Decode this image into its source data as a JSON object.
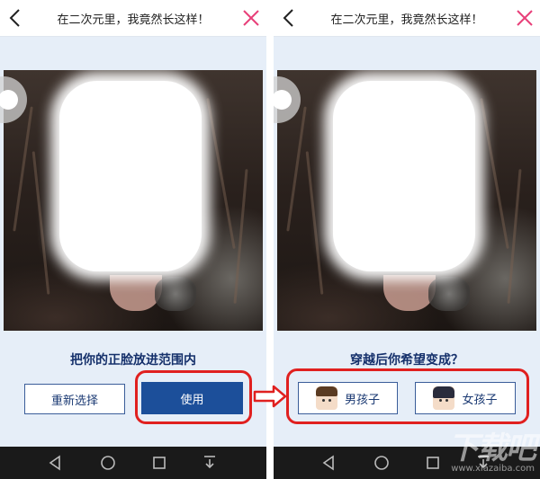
{
  "app": {
    "title": "在二次元里，我竟然长这样！"
  },
  "left_screen": {
    "title": "在二次元里，我竟然长这样！",
    "prompt": "把你的正脸放进范围内",
    "reselect_label": "重新选择",
    "use_label": "使用"
  },
  "right_screen": {
    "title": "在二次元里，我竟然长这样！",
    "prompt": "穿越后你希望变成？",
    "boy_label": "男孩子",
    "girl_label": "女孩子"
  },
  "watermark": {
    "logo": "下载吧",
    "url": "www.xiazaiba.com"
  },
  "icons": {
    "back": "back-chevron-icon",
    "close": "close-x-icon",
    "arrow": "right-arrow-icon",
    "nav": [
      "nav-back-triangle-icon",
      "nav-home-circle-icon",
      "nav-recent-square-icon",
      "nav-down-icon"
    ]
  },
  "colors": {
    "accent": "#1c4f9a",
    "close": "#e8407a",
    "highlight": "#e0201f",
    "prompt_text": "#15306b",
    "background": "#e6eef8"
  }
}
